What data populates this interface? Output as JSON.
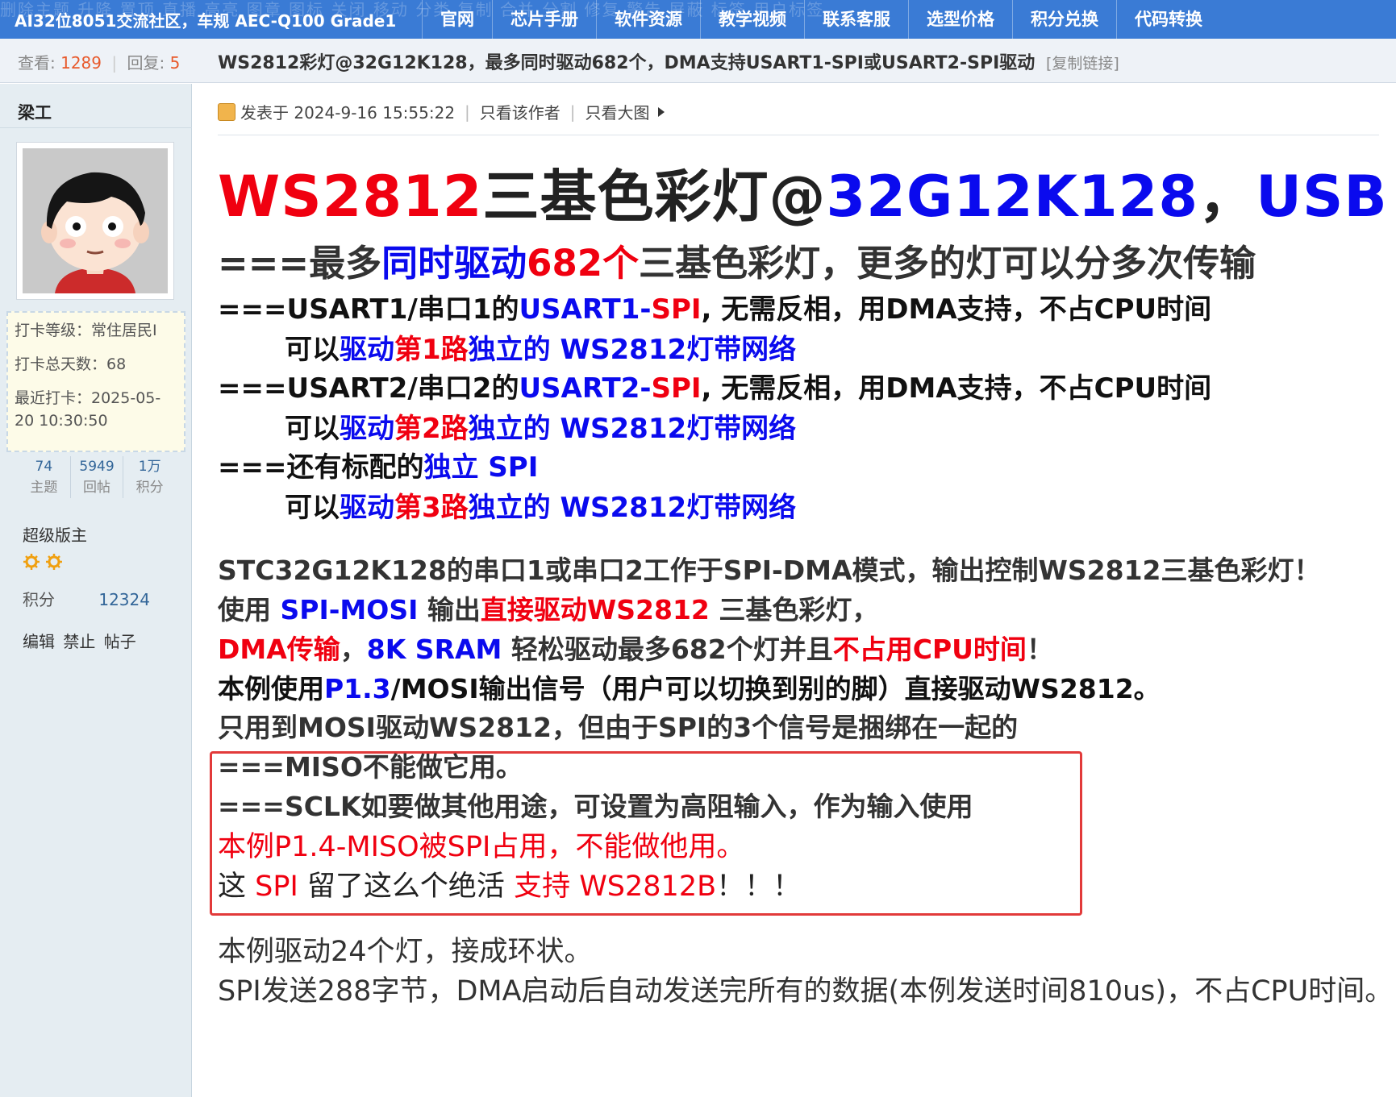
{
  "topnav": {
    "bg_text": "删除主题 升降 置顶 直播 高亮 图章 图标 关闭 移动 分类 复制 合并 分割 修复 警告 屏蔽 标签 用户标签",
    "site_title": "AI32位8051交流社区，车规 AEC-Q100 Grade1",
    "items": [
      "官网",
      "芯片手册",
      "软件资源",
      "教学视频",
      "联系客服",
      "选型价格",
      "积分兑换",
      "代码转换"
    ]
  },
  "stats": {
    "views_label": "查看:",
    "views": "1289",
    "replies_label": "回复:",
    "replies": "5"
  },
  "thread": {
    "title": "WS2812彩灯@32G12K128，最多同时驱动682个，DMA支持USART1-SPI或USART2-SPI驱动",
    "copy_link": "[复制链接]"
  },
  "author": {
    "name": "梁工",
    "checkin_level": "打卡等级：常住居民I",
    "checkin_days": "打卡总天数：68",
    "checkin_last": "最近打卡：2025-05-20 10:30:50",
    "topics": "74",
    "topics_label": "主题",
    "posts": "5949",
    "posts_label": "回帖",
    "points": "1万",
    "points_label": "积分",
    "rank": "超级版主",
    "score_label": "积分",
    "score": "12324",
    "admin_links": [
      "编辑",
      "禁止",
      "帖子"
    ]
  },
  "post": {
    "posted": "发表于 2024-9-16 15:55:22",
    "only_author": "只看该作者",
    "only_big": "只看大图",
    "h1": [
      "WS2812",
      "三基色彩灯@",
      "32G12K128",
      "，",
      "USB"
    ],
    "h2": [
      "===最多",
      "同时驱动",
      "682个",
      "三基色彩灯，更多的灯可以分多次传输"
    ],
    "l1": [
      "===USART1/串口1的",
      "USART1-",
      "SPI",
      ", 无需反相，用DMA支持，不占CPU时间"
    ],
    "l2": [
      "可以",
      "驱动",
      "第1路",
      "独立的 WS2812灯带网络"
    ],
    "l3": [
      "===USART2/串口2的",
      "USART2-",
      "SPI",
      ", 无需反相，用DMA支持，不占CPU时间"
    ],
    "l4": [
      "可以",
      "驱动",
      "第2路",
      "独立的 WS2812灯带网络"
    ],
    "l5": [
      "===还有标配的",
      "独立 SPI"
    ],
    "l6": [
      "可以",
      "驱动",
      "第3路",
      "独立的 WS2812灯带网络"
    ],
    "p1": "STC32G12K128的串口1或串口2工作于SPI-DMA模式，输出控制WS2812三基色彩灯！",
    "p2": [
      "使用 ",
      "SPI-MOSI",
      " 输出",
      "直接驱动WS2812",
      " 三基色彩灯，"
    ],
    "p3": [
      "DMA传输",
      "，",
      "8K SRAM",
      " 轻松驱动最多682个灯并且",
      "不占用CPU时间",
      "！"
    ],
    "p4": [
      "本例使用",
      "P1.3",
      "/MOSI输出信号（用户可以切换到别的脚）直接驱动WS2812。"
    ],
    "b1": "只用到MOSI驱动WS2812，但由于SPI的3个信号是捆绑在一起的",
    "b2": "===MISO不能做它用。",
    "b3": "===SCLK如要做其他用途，可设置为高阻输入，作为输入使用",
    "b4": "本例P1.4-MISO被SPI占用，不能做他用。",
    "p5": [
      "这 ",
      "SPI",
      " 留了这么个绝活 ",
      "支持 WS2812B",
      "！！！"
    ],
    "p6": "本例驱动24个灯，接成环状。",
    "p7": "SPI发送288字节，DMA启动后自动发送完所有的数据(本例发送时间810us)，不占CPU时间。"
  },
  "colors": {
    "nav_bg": "#3a7bd5",
    "red": "#f00010",
    "blue": "#0a0aee",
    "sidebar_bg": "#e5edf2"
  }
}
